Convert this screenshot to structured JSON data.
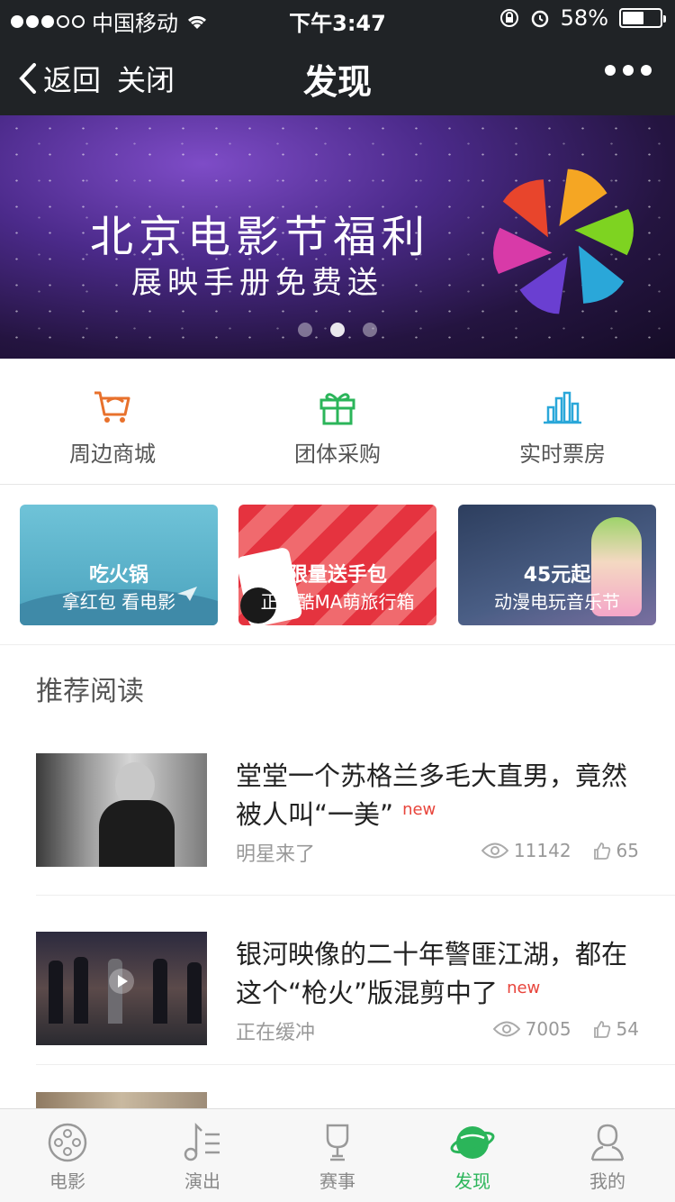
{
  "status_bar": {
    "carrier": "中国移动",
    "time": "下午3:47",
    "battery": "58%",
    "battery_level": 0.58
  },
  "nav": {
    "back_label": "返回",
    "close_label": "关闭",
    "title": "发现"
  },
  "banner": {
    "headline": "北京电影节福利",
    "subline": "展映手册免费送",
    "page_count": 3,
    "active_page": 2
  },
  "quick_links": [
    {
      "label": "周边商城",
      "icon": "shopping-cart-icon",
      "color": "#e8712c"
    },
    {
      "label": "团体采购",
      "icon": "gift-icon",
      "color": "#2bb55a"
    },
    {
      "label": "实时票房",
      "icon": "bar-chart-icon",
      "color": "#2aa7d9"
    }
  ],
  "promos": [
    {
      "title": "吃火锅",
      "subtitle": "拿红包 看电影"
    },
    {
      "title": "限量送手包",
      "subtitle": "正版酷MA萌旅行箱"
    },
    {
      "title": "45元起",
      "subtitle": "动漫电玩音乐节"
    }
  ],
  "section_title": "推荐阅读",
  "articles": [
    {
      "title": "堂堂一个苏格兰多毛大直男，竟然被人叫“一美”",
      "badge": "new",
      "source": "明星来了",
      "views": "11142",
      "likes": "65"
    },
    {
      "title": "银河映像的二十年警匪江湖，都在这个“枪火”版混剪中了",
      "badge": "new",
      "source": "正在缓冲",
      "views": "7005",
      "likes": "54"
    }
  ],
  "tabs": [
    {
      "label": "电影",
      "icon": "film-reel-icon",
      "active": false
    },
    {
      "label": "演出",
      "icon": "music-note-icon",
      "active": false
    },
    {
      "label": "赛事",
      "icon": "trophy-icon",
      "active": false
    },
    {
      "label": "发现",
      "icon": "planet-icon",
      "active": true
    },
    {
      "label": "我的",
      "icon": "user-icon",
      "active": false
    }
  ],
  "colors": {
    "accent": "#2bb55a",
    "nav_bg": "#202326",
    "badge": "#e8453c"
  }
}
